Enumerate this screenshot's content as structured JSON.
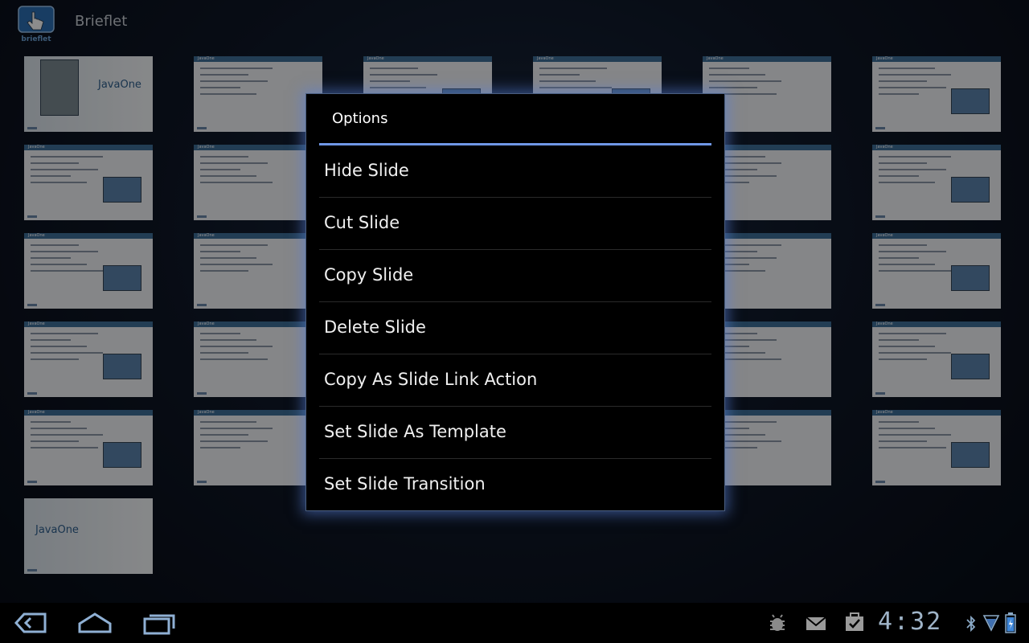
{
  "app": {
    "title": "Brieflet",
    "icon": "hand-pointer-icon",
    "icon_caption": "brieflet"
  },
  "slides": [
    {
      "id": 1,
      "kind": "title",
      "brand": "JavaOne"
    },
    {
      "id": 2,
      "kind": "content",
      "header": "JavaOne"
    },
    {
      "id": 3,
      "kind": "content",
      "header": "JavaOne"
    },
    {
      "id": 4,
      "kind": "content",
      "header": "JavaOne"
    },
    {
      "id": 5,
      "kind": "content",
      "header": "JavaOne"
    },
    {
      "id": 6,
      "kind": "content",
      "header": "JavaOne"
    },
    {
      "id": 7,
      "kind": "content",
      "header": "JavaOne"
    },
    {
      "id": 8,
      "kind": "content",
      "header": "JavaOne"
    },
    {
      "id": 9,
      "kind": "content",
      "header": "JavaOne"
    },
    {
      "id": 10,
      "kind": "content",
      "header": "JavaOne"
    },
    {
      "id": 11,
      "kind": "content",
      "header": "JavaOne"
    },
    {
      "id": 12,
      "kind": "content",
      "header": "JavaOne"
    },
    {
      "id": 13,
      "kind": "content",
      "header": "JavaOne"
    },
    {
      "id": 14,
      "kind": "content",
      "header": "JavaOne"
    },
    {
      "id": 15,
      "kind": "content",
      "header": "JavaOne"
    },
    {
      "id": 16,
      "kind": "content",
      "header": "JavaOne"
    },
    {
      "id": 17,
      "kind": "content",
      "header": "JavaOne"
    },
    {
      "id": 18,
      "kind": "content",
      "header": "JavaOne"
    },
    {
      "id": 19,
      "kind": "content",
      "header": "JavaOne"
    },
    {
      "id": 20,
      "kind": "content",
      "header": "JavaOne"
    },
    {
      "id": 21,
      "kind": "content",
      "header": "JavaOne"
    },
    {
      "id": 22,
      "kind": "content",
      "header": "JavaOne"
    },
    {
      "id": 23,
      "kind": "content",
      "header": "JavaOne"
    },
    {
      "id": 24,
      "kind": "content",
      "header": "JavaOne"
    },
    {
      "id": 25,
      "kind": "content",
      "header": "JavaOne"
    },
    {
      "id": 26,
      "kind": "content",
      "header": "JavaOne"
    },
    {
      "id": 27,
      "kind": "content",
      "header": "JavaOne"
    },
    {
      "id": 28,
      "kind": "content",
      "header": "JavaOne"
    },
    {
      "id": 29,
      "kind": "content",
      "header": "JavaOne"
    },
    {
      "id": 30,
      "kind": "content",
      "header": "JavaOne"
    },
    {
      "id": 31,
      "kind": "title",
      "brand": "JavaOne"
    }
  ],
  "dialog": {
    "title": "Options",
    "options": [
      "Hide Slide",
      "Cut Slide",
      "Copy Slide",
      "Delete Slide",
      "Copy As Slide Link Action",
      "Set Slide As Template",
      "Set Slide Transition"
    ]
  },
  "system_bar": {
    "nav": [
      "back-icon",
      "home-icon",
      "recent-apps-icon"
    ],
    "status_icons": [
      "android-debug-icon",
      "gmail-icon",
      "task-check-icon",
      "bluetooth-icon",
      "signal-icon",
      "battery-icon"
    ],
    "time": "4:32"
  },
  "colors": {
    "accent": "#6f97e6",
    "dialog_bg": "#000000",
    "clock": "#9fb4c8"
  }
}
